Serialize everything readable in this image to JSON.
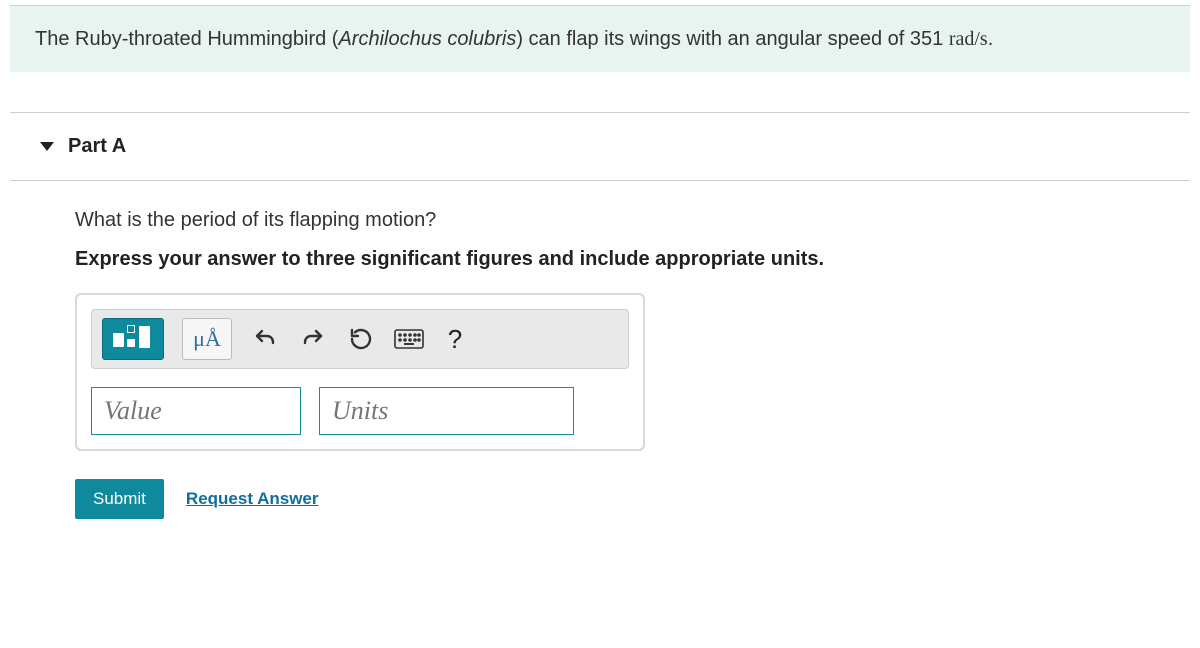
{
  "prompt": {
    "text_before": "The Ruby-throated Hummingbird (",
    "species": "Archilochus colubris",
    "text_after": ") can flap its wings with an angular speed of 351 ",
    "unit": "rad/s",
    "period": "."
  },
  "part": {
    "label": "Part A"
  },
  "question": "What is the period of its flapping motion?",
  "instruction": "Express your answer to three significant figures and include appropriate units.",
  "toolbar": {
    "symbols_label": "μÅ",
    "help_label": "?"
  },
  "inputs": {
    "value_placeholder": "Value",
    "units_placeholder": "Units"
  },
  "actions": {
    "submit": "Submit",
    "request": "Request Answer"
  }
}
